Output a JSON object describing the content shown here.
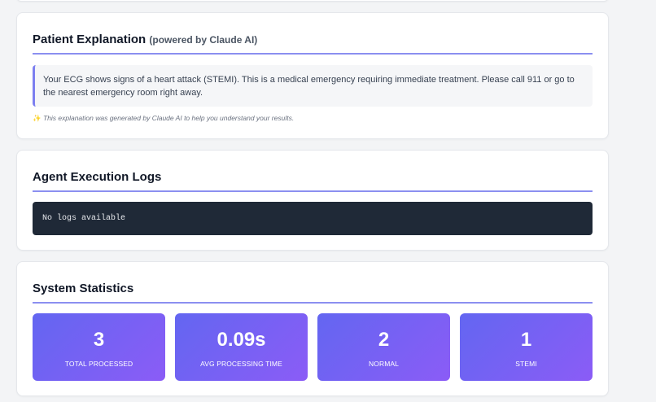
{
  "patient_explanation": {
    "title": "Patient Explanation",
    "title_suffix": "(powered by Claude AI)",
    "text": "Your ECG shows signs of a heart attack (STEMI). This is a medical emergency requiring immediate treatment. Please call 911 or go to the nearest emergency room right away.",
    "note_icon": "sparkles-icon",
    "note": "This explanation was generated by Claude AI to help you understand your results."
  },
  "agent_logs": {
    "title": "Agent Execution Logs",
    "content": "No logs available"
  },
  "system_stats": {
    "title": "System Statistics",
    "items": [
      {
        "value": "3",
        "label": "TOTAL PROCESSED"
      },
      {
        "value": "0.09s",
        "label": "AVG PROCESSING TIME"
      },
      {
        "value": "2",
        "label": "NORMAL"
      },
      {
        "value": "1",
        "label": "STEMI"
      }
    ]
  },
  "colors": {
    "accent": "#8b8ff0",
    "gradient_start": "#6366f1",
    "gradient_end": "#8b5cf6",
    "log_bg": "#1f2937"
  }
}
